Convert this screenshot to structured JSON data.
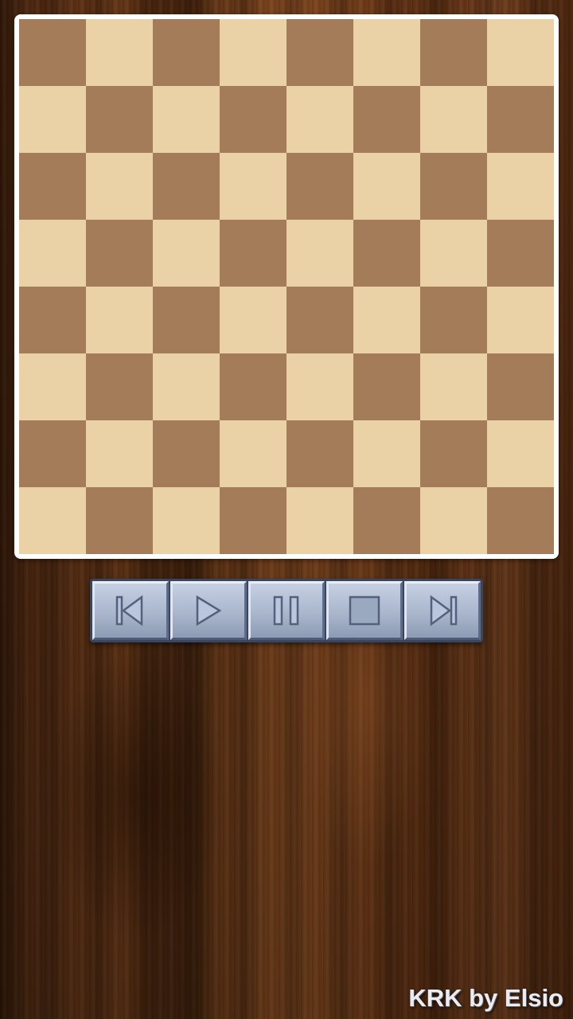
{
  "board": {
    "size": 8,
    "colors": {
      "light": "#ead1a6",
      "dark": "#a57c5a",
      "frame": "#ffffff"
    },
    "top_left_square": "dark"
  },
  "controls": [
    {
      "name": "first-move-button",
      "icon": "skip-to-start-icon"
    },
    {
      "name": "play-button",
      "icon": "play-icon"
    },
    {
      "name": "pause-button",
      "icon": "pause-icon"
    },
    {
      "name": "stop-button",
      "icon": "stop-icon"
    },
    {
      "name": "last-move-button",
      "icon": "skip-to-end-icon"
    }
  ],
  "credit": "KRK by Elsio"
}
